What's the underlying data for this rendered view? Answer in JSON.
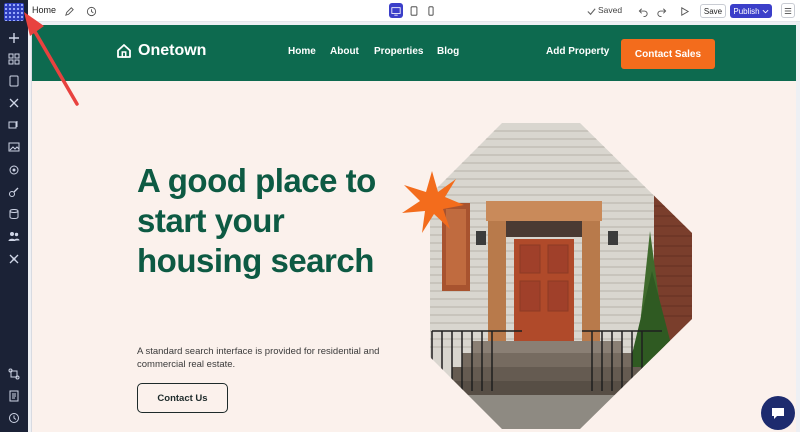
{
  "editor": {
    "page_name": "Home",
    "saved_label": "Saved",
    "save_label": "Save",
    "publish_label": "Publish"
  },
  "site": {
    "brand": "Onetown",
    "nav": [
      "Home",
      "About",
      "Properties",
      "Blog"
    ],
    "add_property": "Add Property",
    "contact_sales": "Contact Sales",
    "hero_title": "A good place to start your housing search",
    "hero_subtitle": "A standard search interface is provided for residential and commercial real estate.",
    "contact_us": "Contact Us"
  },
  "colors": {
    "sidebar": "#1b2236",
    "header_green": "#0d6a4f",
    "accent_orange": "#f36c1c",
    "hero_bg": "#fbf1ec",
    "title_green": "#0d5a43",
    "publish_blue": "#3b3fc9",
    "arrow_red": "#e8423f"
  }
}
